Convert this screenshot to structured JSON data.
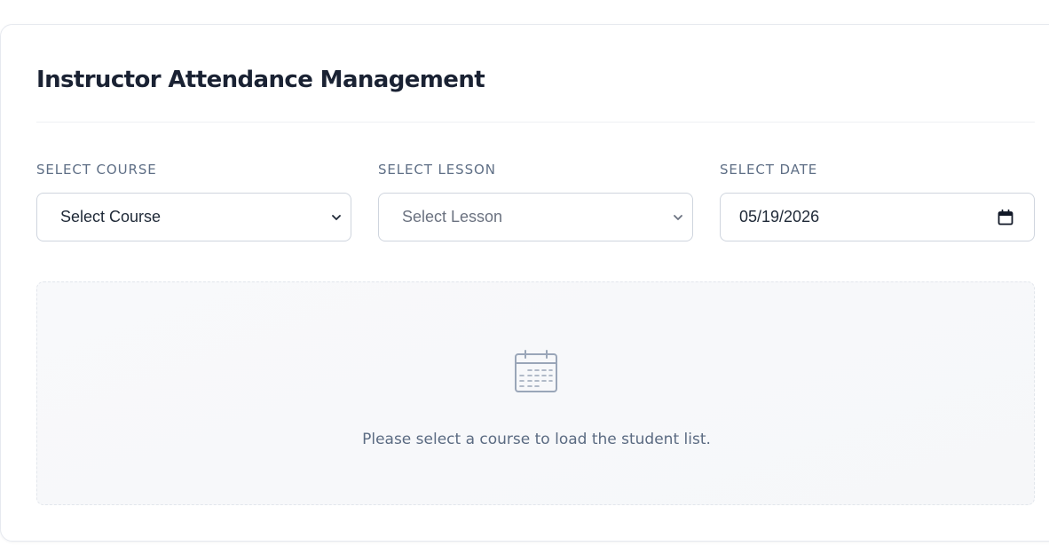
{
  "header": {
    "title": "Instructor Attendance Management"
  },
  "filters": {
    "course": {
      "label": "SELECT COURSE",
      "value": "Select Course"
    },
    "lesson": {
      "label": "SELECT LESSON",
      "value": "Select Lesson"
    },
    "date": {
      "label": "SELECT DATE",
      "value": "05/19/2026"
    }
  },
  "empty_state": {
    "icon": "calendar-icon",
    "message": "Please select a course to load the student list."
  },
  "colors": {
    "title": "#1a2233",
    "label": "#5f6f86",
    "border": "#cfd5de",
    "empty_bg": "#f8f9fb",
    "icon": "#9aa6b8"
  }
}
